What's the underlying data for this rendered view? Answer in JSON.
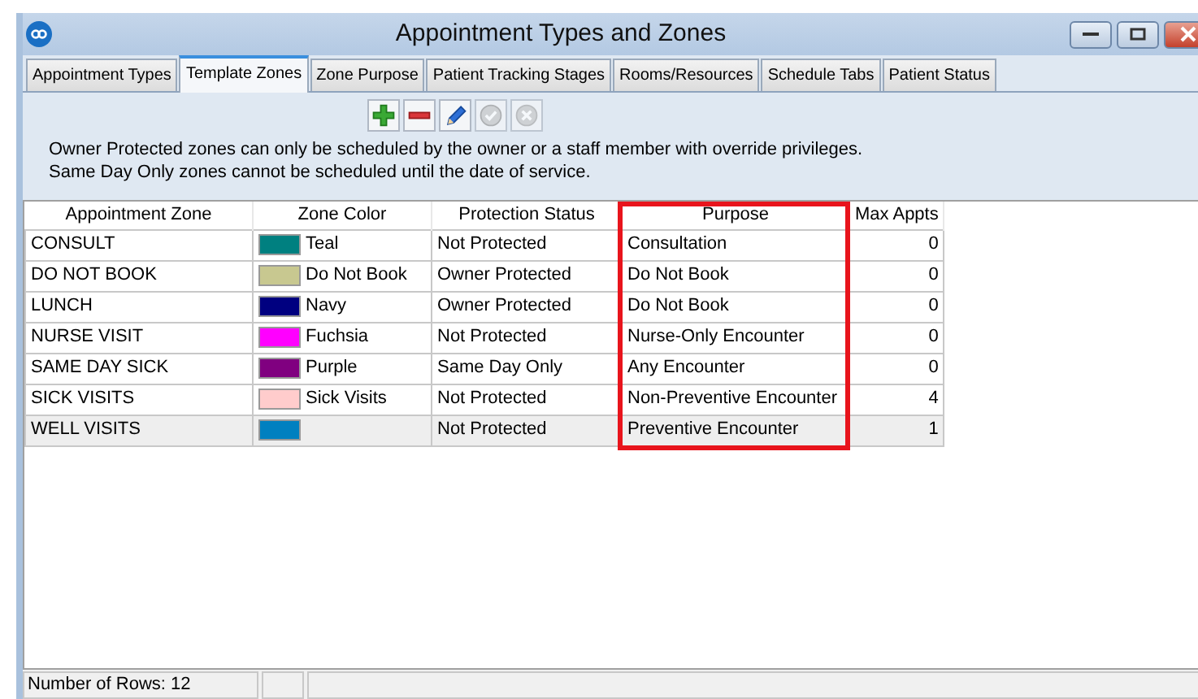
{
  "window": {
    "title": "Appointment Types and Zones"
  },
  "tabs": [
    {
      "label": "Appointment Types",
      "selected": false
    },
    {
      "label": "Template Zones",
      "selected": true
    },
    {
      "label": "Zone Purpose",
      "selected": false
    },
    {
      "label": "Patient Tracking Stages",
      "selected": false
    },
    {
      "label": "Rooms/Resources",
      "selected": false
    },
    {
      "label": "Schedule Tabs",
      "selected": false
    },
    {
      "label": "Patient Status",
      "selected": false
    }
  ],
  "toolbar": [
    {
      "kind": "add",
      "disabled": false
    },
    {
      "kind": "remove",
      "disabled": false
    },
    {
      "kind": "edit",
      "disabled": false
    },
    {
      "kind": "save",
      "disabled": true
    },
    {
      "kind": "cancel",
      "disabled": true
    }
  ],
  "notes": [
    "Owner Protected zones can only be scheduled by the owner or a staff member with override privileges.",
    "Same Day Only zones cannot be scheduled until the date of service."
  ],
  "table": {
    "columns": [
      {
        "label": "Appointment Zone",
        "highlighted": false
      },
      {
        "label": "Zone Color",
        "highlighted": false
      },
      {
        "label": "Protection Status",
        "highlighted": false
      },
      {
        "label": "Purpose",
        "highlighted": true
      },
      {
        "label": "Max Appts",
        "highlighted": false
      }
    ],
    "rows": [
      {
        "zone": "CONSULT",
        "color": "#008080",
        "color_name": "Teal",
        "protection": "Not Protected",
        "purpose": "Consultation",
        "max": "0",
        "selected": false
      },
      {
        "zone": "DO NOT BOOK",
        "color": "#c8c890",
        "color_name": "Do Not Book",
        "protection": "Owner Protected",
        "purpose": "Do Not Book",
        "max": "0",
        "selected": false
      },
      {
        "zone": "LUNCH",
        "color": "#000080",
        "color_name": "Navy",
        "protection": "Owner Protected",
        "purpose": "Do Not Book",
        "max": "0",
        "selected": false
      },
      {
        "zone": "NURSE VISIT",
        "color": "#ff00ff",
        "color_name": "Fuchsia",
        "protection": "Not Protected",
        "purpose": "Nurse-Only Encounter",
        "max": "0",
        "selected": false
      },
      {
        "zone": "SAME DAY SICK",
        "color": "#800080",
        "color_name": "Purple",
        "protection": "Same Day Only",
        "purpose": "Any Encounter",
        "max": "0",
        "selected": false
      },
      {
        "zone": "SICK VISITS",
        "color": "#ffcccc",
        "color_name": "Sick Visits",
        "protection": "Not Protected",
        "purpose": "Non-Preventive Encounter",
        "max": "4",
        "selected": false
      },
      {
        "zone": "WELL VISITS",
        "color": "#0080c0",
        "protection": "Not Protected",
        "purpose": "Preventive Encounter",
        "max": "1",
        "selected": true
      }
    ]
  },
  "status_bar": {
    "text": "Number of Rows: 12"
  }
}
